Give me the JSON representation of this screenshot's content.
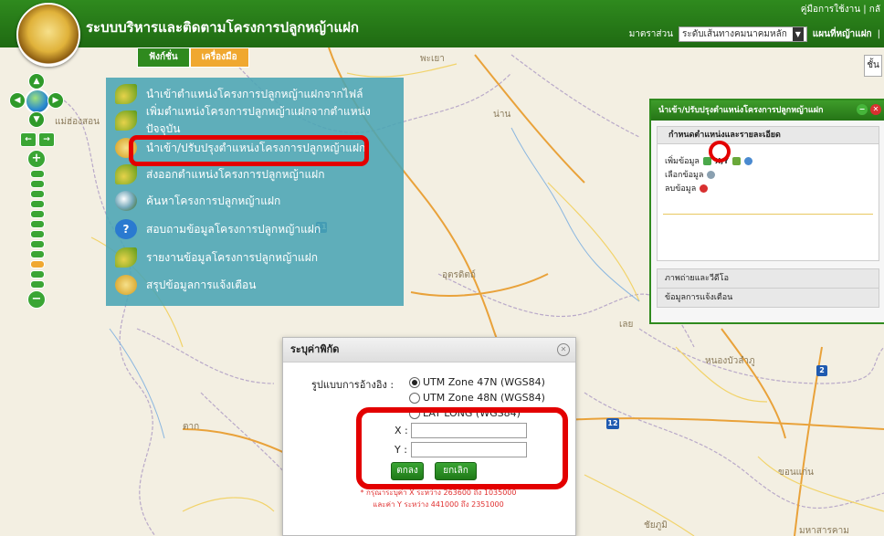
{
  "header": {
    "title": "ระบบบริหารและติดตามโครงการปลูกหญ้าแฝก",
    "links": "คู่มือการใช้งาน  |  กลั",
    "scale_label": "มาตราส่วน",
    "scale_value": "ระดับเส้นทางคมนาคมหลัก",
    "map_label": "แผนที่หญ้าแฝก",
    "tab_function": "ฟังก์ชั่น",
    "tab_tools": "เครื่องมือ",
    "right_btn": "ชั้น"
  },
  "map_labels": {
    "l1": "พะเยา",
    "l2": "แม่ฮ่องสอน",
    "l3": "น่าน",
    "l4": "อุตรดิตถ์",
    "l5": "เลย",
    "l6": "หนองบัวลำภู",
    "l7": "ตาก",
    "l8": "ขอนแก่น",
    "l9": "ชัยภูมิ",
    "l10": "มหาสารคาม",
    "route12": "12",
    "route2": "2",
    "route31": "11"
  },
  "menu": {
    "items": [
      {
        "label": "นำเข้าตำแหน่งโครงการปลูกหญ้าแฝกจากไฟล์"
      },
      {
        "label": "เพิ่มตำแหน่งโครงการปลูกหญ้าแฝกจากตำแหน่งปัจจุบัน"
      },
      {
        "label": "นำเข้า/ปรับปรุงตำแหน่งโครงการปลูกหญ้าแฝก"
      },
      {
        "label": "ส่งออกตำแหน่งโครงการปลูกหญ้าแฝก"
      },
      {
        "label": "ค้นหาโครงการปลูกหญ้าแฝก"
      },
      {
        "label": "สอบถามข้อมูลโครงการปลูกหญ้าแฝก"
      },
      {
        "label": "รายงานข้อมูลโครงการปลูกหญ้าแฝก"
      },
      {
        "label": "สรุปข้อมูลการแจ้งเตือน"
      }
    ]
  },
  "right_panel": {
    "title": "นำเข้า/ปรับปรุงตำแหน่งโครงการปลูกหญ้าแฝก",
    "section": "กำหนดตำแหน่งและรายละเอียด",
    "add_data": "เพิ่มข้อมูล",
    "kt_label": "X,Y",
    "select_data": "เลือกข้อมูล",
    "delete_data": "ลบข้อมูล",
    "footer1": "ภาพถ่ายและวีดีโอ",
    "footer2": "ข้อมูลการแจ้งเตือน"
  },
  "dialog": {
    "title": "ระบุค่าพิกัด",
    "ref_label": "รูปแบบการอ้างอิง :",
    "options": [
      "UTM Zone 47N (WGS84)",
      "UTM Zone 48N (WGS84)",
      "LAT LONG (WGS84)"
    ],
    "selected_option": "UTM Zone 47N (WGS84)",
    "x_label": "X :",
    "y_label": "Y :",
    "x_value": "",
    "y_value": "",
    "ok": "ตกลง",
    "cancel": "ยกเลิก",
    "note1": "* กรุณาระบุค่า X ระหว่าง 263600 ถึง 1035000",
    "note2": "และค่า Y ระหว่าง 441000 ถึง 2351000"
  },
  "colors": {
    "header_green": "#2f8a1e",
    "highlight_red": "#e30000",
    "menu_teal": "#4aa5b4",
    "tools_orange": "#f0a830"
  }
}
